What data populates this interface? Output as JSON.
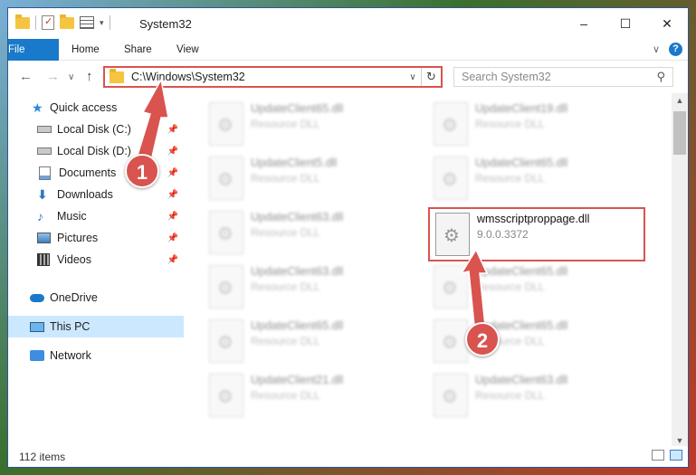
{
  "window": {
    "title": "System32",
    "controls": {
      "minimize": "–",
      "maximize": "☐",
      "close": "✕"
    }
  },
  "ribbon": {
    "tabs": [
      "File",
      "Home",
      "Share",
      "View"
    ],
    "expand_glyph": "∨",
    "help_glyph": "?"
  },
  "nav": {
    "back": "←",
    "forward": "→",
    "recent": "∨",
    "up": "↑"
  },
  "address": {
    "path": "C:\\Windows\\System32",
    "dropdown": "∨",
    "refresh": "↻"
  },
  "search": {
    "placeholder": "Search System32",
    "icon": "search-icon"
  },
  "sidebar": {
    "items": [
      {
        "label": "Quick access",
        "icon": "star-icon"
      },
      {
        "label": "Local Disk (C:)",
        "icon": "drive-icon",
        "pinned": true
      },
      {
        "label": "Local Disk (D:)",
        "icon": "drive-icon",
        "pinned": true
      },
      {
        "label": "Documents",
        "icon": "documents-icon",
        "pinned": true
      },
      {
        "label": "Downloads",
        "icon": "download-icon",
        "pinned": true
      },
      {
        "label": "Music",
        "icon": "music-icon",
        "pinned": true
      },
      {
        "label": "Pictures",
        "icon": "pictures-icon",
        "pinned": true
      },
      {
        "label": "Videos",
        "icon": "videos-icon",
        "pinned": true
      },
      {
        "label": "OneDrive",
        "icon": "cloud-icon"
      },
      {
        "label": "This PC",
        "icon": "computer-icon",
        "selected": true
      },
      {
        "label": "Network",
        "icon": "network-icon"
      }
    ]
  },
  "files": {
    "left": [
      {
        "name": "UpdateClient65.dll",
        "type": "Resource DLL"
      },
      {
        "name": "UpdateClient5.dll",
        "type": "Resource DLL"
      },
      {
        "name": "UpdateClient63.dll",
        "type": "Resource DLL"
      },
      {
        "name": "UpdateClient63.dll",
        "type": "Resource DLL"
      },
      {
        "name": "UpdateClient65.dll",
        "type": "Resource DLL"
      },
      {
        "name": "UpdateClient21.dll",
        "type": "Resource DLL"
      }
    ],
    "right": [
      {
        "name": "UpdateClient19.dll",
        "type": "Resource DLL"
      },
      {
        "name": "UpdateClient65.dll",
        "type": "Resource DLL"
      },
      {
        "name": "wmsscriptproppage.dll",
        "type": "9.0.0.3372",
        "highlighted": true
      },
      {
        "name": "UpdateClient65.dll",
        "type": "Resource DLL"
      },
      {
        "name": "UpdateClient65.dll",
        "type": "Resource DLL"
      },
      {
        "name": "UpdateClient63.dll",
        "type": "Resource DLL"
      }
    ]
  },
  "status": {
    "item_count": "112 items"
  },
  "annotations": {
    "step1": "1",
    "step2": "2",
    "color": "#d9534f"
  }
}
